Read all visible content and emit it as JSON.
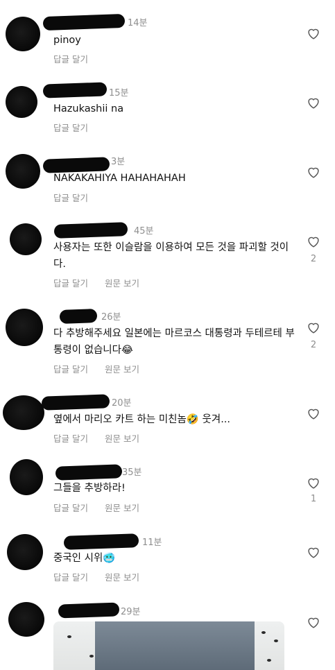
{
  "comments": [
    {
      "time": "14분",
      "text": "pinoy",
      "reply_label": "답글 달기"
    },
    {
      "time": "15분",
      "text": "Hazukashii na",
      "reply_label": "답글 달기"
    },
    {
      "time": "3분",
      "text": "NAKAKAHIYA HAHAHAHAH",
      "reply_label": "답글 달기"
    },
    {
      "time": "45분",
      "text": "사용자는 또한 이슬람을 이용하여 모든 것을 파괴할 것이다.",
      "reply_label": "답글 달기",
      "original_label": "원문 보기",
      "likes": "2"
    },
    {
      "time": "26분",
      "text": "다 추방해주세요 일본에는 마르코스 대통령과 두테르테 부통령이 없습니다😂",
      "reply_label": "답글 달기",
      "original_label": "원문 보기",
      "likes": "2"
    },
    {
      "time": "20분",
      "text": "옆에서 마리오 카트 하는 미친놈🤣 웃겨...",
      "reply_label": "답글 달기",
      "original_label": "원문 보기"
    },
    {
      "time": "35분",
      "text": "그들을 추방하라!",
      "reply_label": "답글 달기",
      "original_label": "원문 보기",
      "likes": "1"
    },
    {
      "time": "11분",
      "text": "중국인 시위🥶",
      "reply_label": "답글 달기",
      "original_label": "원문 보기"
    },
    {
      "time": "29분"
    }
  ],
  "icons": {
    "like": "heart-outline-icon"
  },
  "colors": {
    "text": "#111111",
    "muted": "#8e8e8e",
    "background": "#ffffff"
  }
}
